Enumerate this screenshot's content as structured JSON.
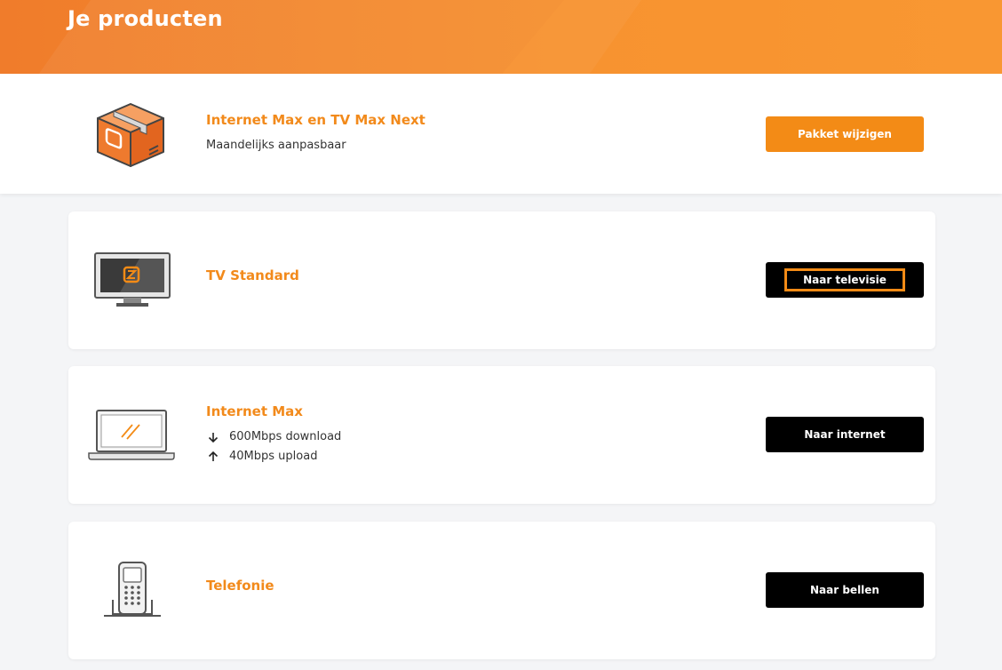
{
  "header": {
    "title": "Je producten"
  },
  "package": {
    "title": "Internet Max en TV Max Next",
    "subtitle": "Maandelijks aanpasbaar",
    "button_label": "Pakket wijzigen",
    "icon": "package-box-icon"
  },
  "products": [
    {
      "title": "TV Standard",
      "button_label": "Naar televisie",
      "icon": "tv-icon"
    },
    {
      "title": "Internet Max",
      "download": "600Mbps download",
      "upload": "40Mbps upload",
      "button_label": "Naar internet",
      "icon": "laptop-icon"
    },
    {
      "title": "Telefonie",
      "button_label": "Naar bellen",
      "icon": "phone-icon"
    }
  ],
  "colors": {
    "brand": "#f38b16",
    "header": "#f58e2c",
    "button_dark": "#000000"
  }
}
